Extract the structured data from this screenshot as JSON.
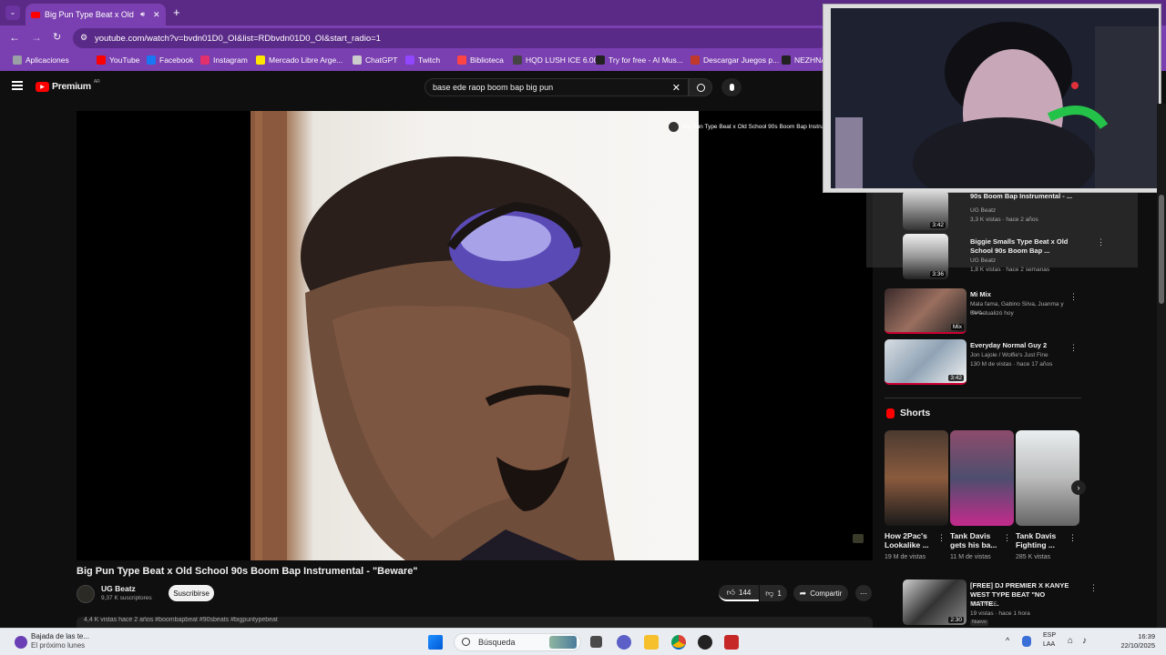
{
  "browser": {
    "tab_title": "Big Pun Type Beat x Old Sc",
    "url": "youtube.com/watch?v=bvdn01D0_OI&list=RDbvdn01D0_OI&start_radio=1",
    "bookmarks": [
      {
        "label": "Aplicaciones",
        "icon": "grid-icon",
        "color": "#9aa0a6"
      },
      {
        "label": "YouTube",
        "icon": "youtube-icon",
        "color": "#ff0000"
      },
      {
        "label": "Facebook",
        "icon": "facebook-icon",
        "color": "#1877f2"
      },
      {
        "label": "Instagram",
        "icon": "instagram-icon",
        "color": "#e1306c"
      },
      {
        "label": "Mercado Libre Arge...",
        "icon": "mercadolibre-icon",
        "color": "#ffe600"
      },
      {
        "label": "ChatGPT",
        "icon": "chatgpt-icon",
        "color": "#cccccc"
      },
      {
        "label": "Twitch",
        "icon": "twitch-icon",
        "color": "#9146ff"
      },
      {
        "label": "Biblioteca",
        "icon": "library-icon",
        "color": "#ff4444"
      },
      {
        "label": "HQD LUSH ICE 6.00...",
        "icon": "store-icon",
        "color": "#444444"
      },
      {
        "label": "Try for free - AI Mus...",
        "icon": "dollar-icon",
        "color": "#222222"
      },
      {
        "label": "Descargar Juegos p...",
        "icon": "game-icon",
        "color": "#c0392b"
      },
      {
        "label": "NEZHNA",
        "icon": "n-icon",
        "color": "#222222"
      }
    ]
  },
  "youtube": {
    "logo_label": "Premium",
    "logo_region": "AR",
    "search_query": "base ede raop boom bap big pun",
    "accent": "#ff0000"
  },
  "player": {
    "overlay_title": "Big Pun Type Beat x Old School 90s Boom Bap Instrumental"
  },
  "video": {
    "title": "Big Pun Type Beat x Old School 90s Boom Bap Instrumental - \"Beware\"",
    "channel": "UG Beatz",
    "subscribers": "9,37 K suscriptores",
    "subscribe_label": "Suscribirse",
    "likes": "144",
    "dislikes": "1",
    "share_label": "Compartir",
    "description_peek": "4,4 K vistas  hace 2 años  #boombapbeat #90sbeats #bigpuntypebeat"
  },
  "sidebar": {
    "items": [
      {
        "title": "90s Boom Bap Instrumental - ...",
        "channel": "UG Beatz",
        "meta": "3,3 K vistas · hace 2 años",
        "duration": "3:42"
      },
      {
        "title": "Biggie Smalls Type Beat x Old School 90s Boom Bap ...",
        "channel": "UG Beatz",
        "meta": "1,8 K vistas · hace 2 semanas",
        "duration": "3:36"
      },
      {
        "title": "Mi Mix",
        "channel": "Mala fama, Gabino Silva, Juanma y muc...",
        "meta": "Se actualizó hoy",
        "duration": "Mix"
      },
      {
        "title": "Everyday Normal Guy 2",
        "channel": "Jon Lajoie / Wolfie's Just Fine",
        "meta": "130 M de vistas · hace 17 años",
        "duration": "3:42"
      }
    ],
    "shorts_label": "Shorts",
    "shorts": [
      {
        "title": "How 2Pac's Lookalike ...",
        "views": "19 M de vistas"
      },
      {
        "title": "Tank Davis gets his ba...",
        "views": "11 M de vistas"
      },
      {
        "title": "Tank Davis Fighting ...",
        "views": "285 K vistas"
      }
    ],
    "bottom_item": {
      "title": "[FREE] DJ PREMIER X KANYE WEST TYPE BEAT \"NO MATTE...",
      "channel": "RAF NITE",
      "meta": "19 vistas · hace 1 hora",
      "badge": "Nuevo",
      "duration": "2:30"
    }
  },
  "taskbar": {
    "weather_title": "Bajada de las te...",
    "weather_subtitle": "El próximo lunes",
    "search_label": "Búsqueda",
    "lang_top": "ESP",
    "lang_bottom": "LAA",
    "time": "16:39",
    "date": "22/10/2025"
  }
}
